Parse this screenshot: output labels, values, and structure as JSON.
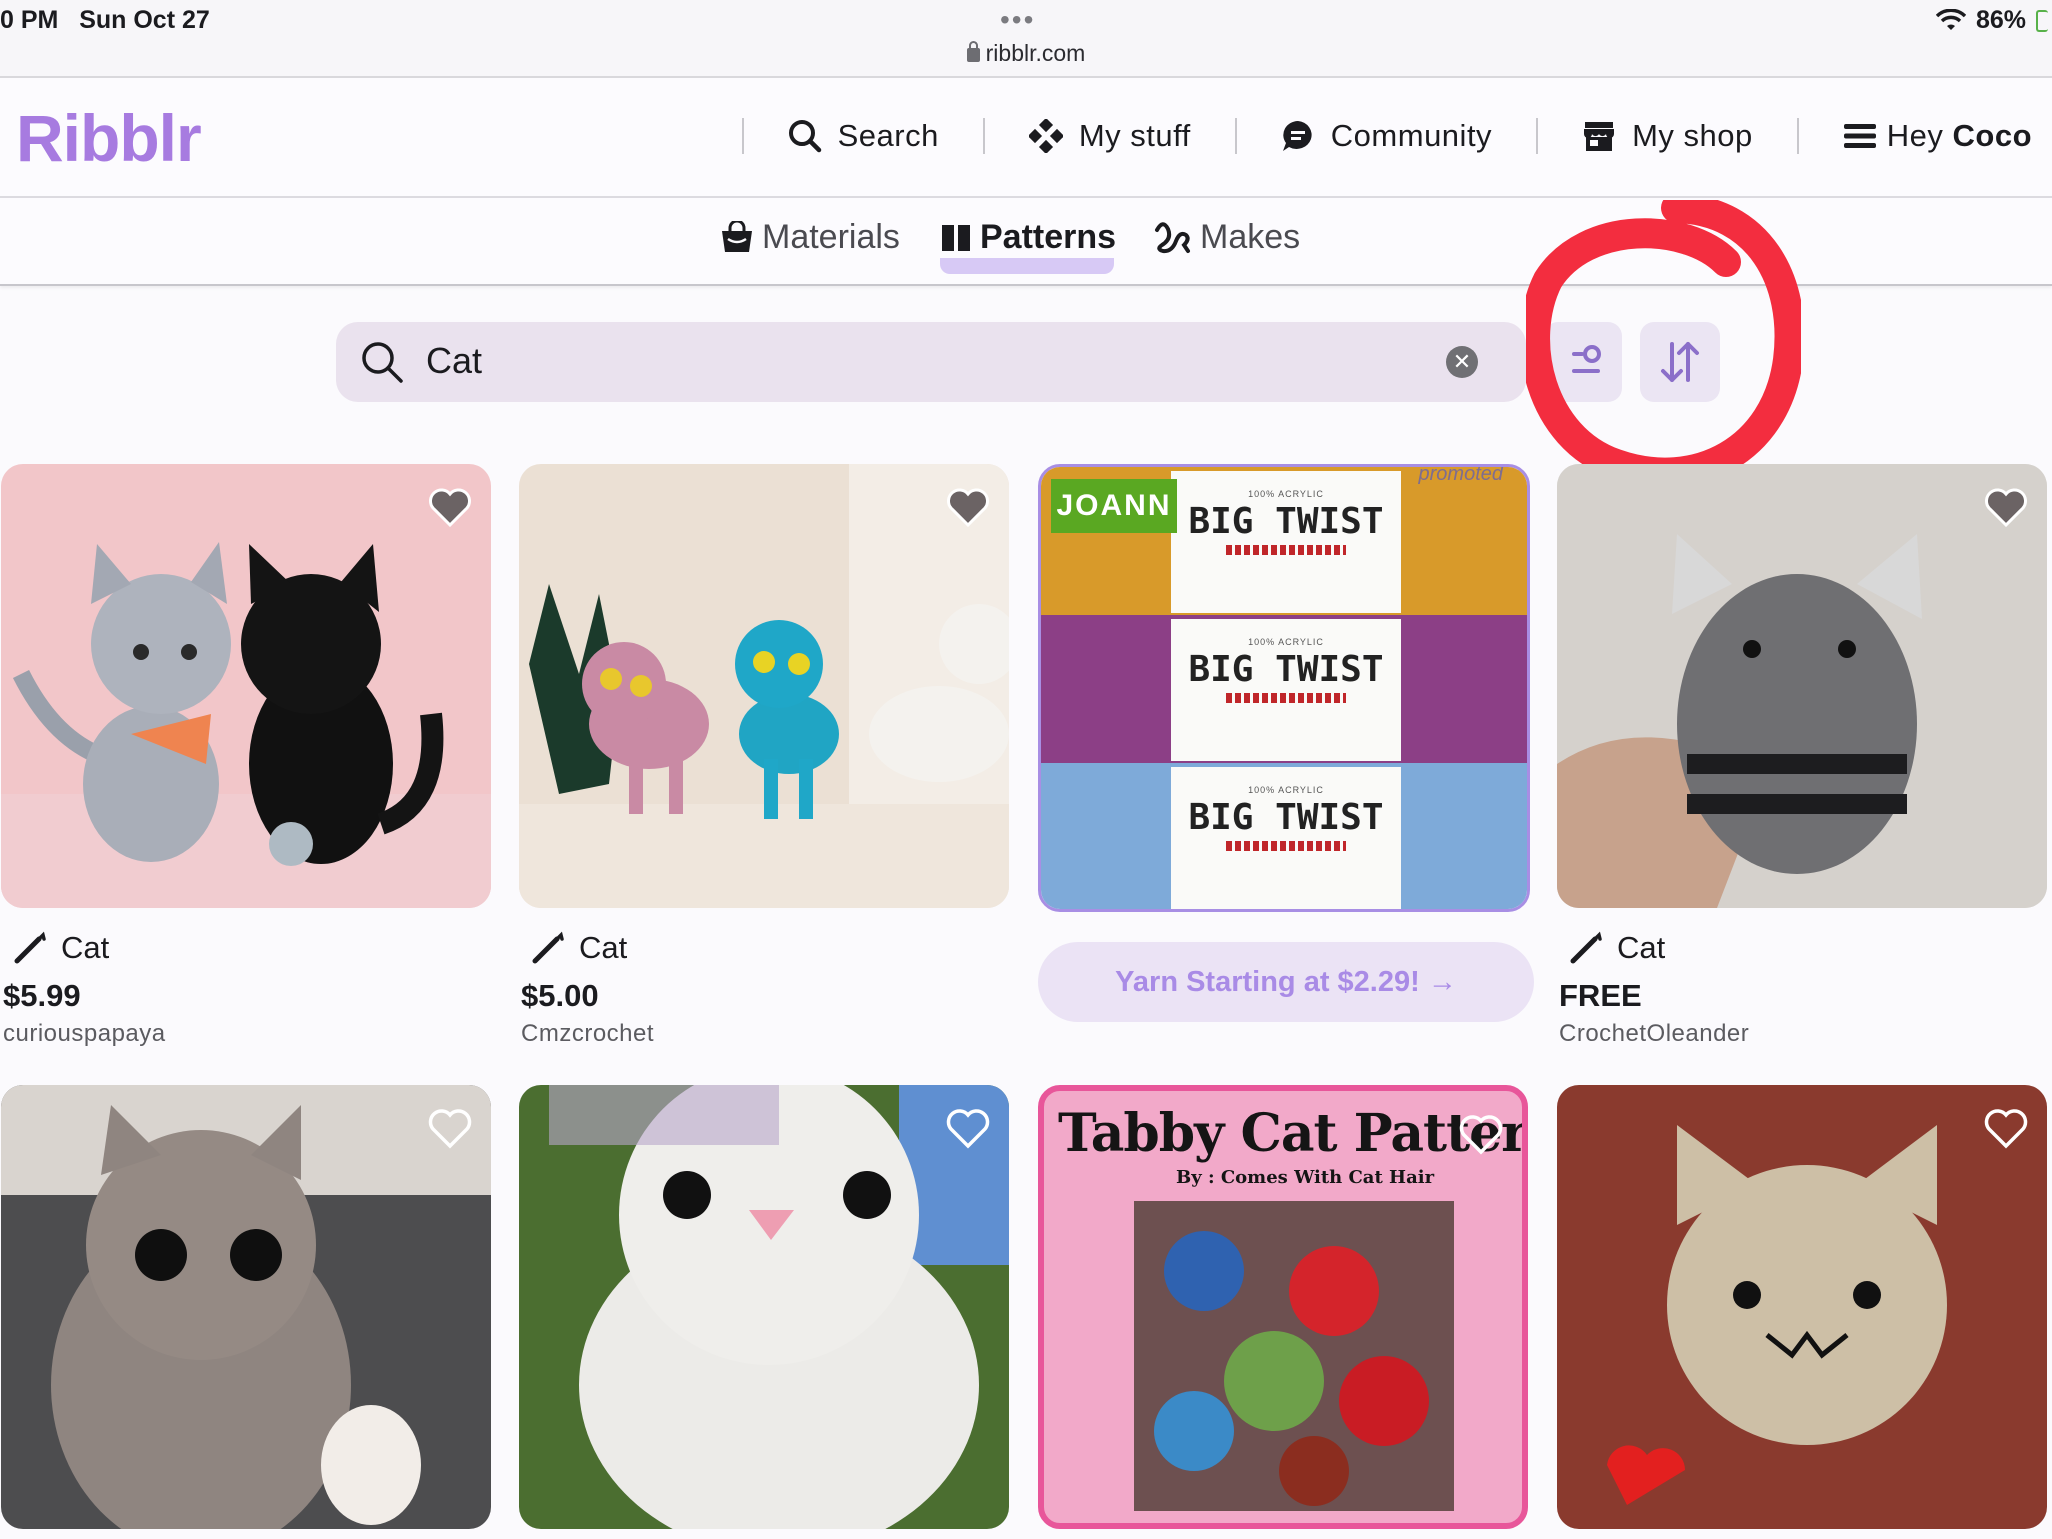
{
  "status_bar": {
    "time": "0 PM",
    "date": "Sun Oct 27",
    "url": "ribblr.com",
    "battery": "86%"
  },
  "header": {
    "logo": "Ribblr",
    "nav": [
      {
        "label": "Search",
        "icon": "search-icon"
      },
      {
        "label": "My stuff",
        "icon": "my-stuff-icon"
      },
      {
        "label": "Community",
        "icon": "community-chat-icon"
      },
      {
        "label": "My shop",
        "icon": "shop-icon"
      }
    ],
    "greeting_prefix": "Hey",
    "greeting_name": "Coco"
  },
  "tabs": [
    {
      "label": "Materials",
      "icon": "bag-icon",
      "active": false
    },
    {
      "label": "Patterns",
      "icon": "book-icon",
      "active": true
    },
    {
      "label": "Makes",
      "icon": "makes-icon",
      "active": false
    }
  ],
  "search": {
    "value": "Cat",
    "placeholder": ""
  },
  "toolbar": {
    "filter_icon": "filter-icon",
    "sort_icon": "sort-arrows-icon"
  },
  "annotation_color": "#f32d3f",
  "accent_color": "#a77be0",
  "results": [
    {
      "title": "Cat",
      "price": "$5.99",
      "author": "curiouspapaya",
      "favorited": true,
      "craft_icon": "crochet-hook-icon"
    },
    {
      "title": "Cat",
      "price": "$5.00",
      "author": "Cmzcrochet",
      "favorited": true,
      "craft_icon": "crochet-hook-icon"
    },
    {
      "promoted_label": "promoted",
      "brand": "JOANN",
      "product": "BIG TWIST",
      "product_line": "100% ACRYLIC",
      "cta": "Yarn Starting at $2.29! →"
    },
    {
      "title": "Cat",
      "price": "FREE",
      "author": "CrochetOleander",
      "favorited": true,
      "craft_icon": "crochet-hook-icon"
    },
    {
      "favorited": false
    },
    {
      "favorited": false
    },
    {
      "title_text": "Tabby Cat Pattern",
      "subtitle_text": "By : Comes With Cat Hair",
      "favorited": false
    },
    {
      "favorited": false
    }
  ]
}
